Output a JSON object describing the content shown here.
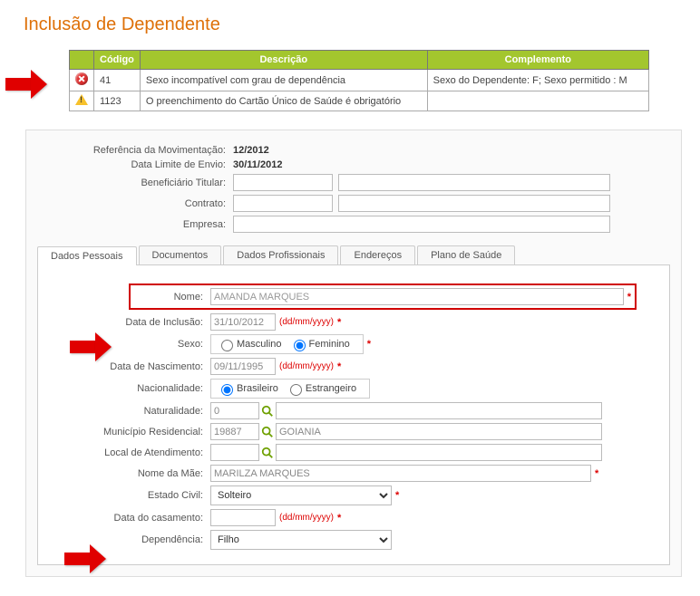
{
  "page_title": "Inclusão de Dependente",
  "errors_table": {
    "headers": {
      "code": "Código",
      "desc": "Descrição",
      "comp": "Complemento"
    },
    "rows": [
      {
        "icon": "error",
        "code": "41",
        "desc": "Sexo incompatível com grau de dependência",
        "comp": "Sexo do Dependente: F; Sexo permitido : M"
      },
      {
        "icon": "warn",
        "code": "1123",
        "desc": "O preenchimento do Cartão Único de Saúde é obrigatório",
        "comp": ""
      }
    ]
  },
  "info": {
    "ref_label": "Referência da Movimentação:",
    "ref_value": "12/2012",
    "limit_label": "Data Limite de Envio:",
    "limit_value": "30/11/2012",
    "titular_label": "Beneficiário Titular:",
    "contrato_label": "Contrato:",
    "empresa_label": "Empresa:"
  },
  "tabs": [
    "Dados Pessoais",
    "Documentos",
    "Dados Profissionais",
    "Endereços",
    "Plano de Saúde"
  ],
  "form": {
    "nome_label": "Nome:",
    "nome_value": "AMANDA MARQUES",
    "incl_label": "Data de Inclusão:",
    "incl_value": "31/10/2012",
    "sexo_label": "Sexo:",
    "sexo_m": "Masculino",
    "sexo_f": "Feminino",
    "nasc_label": "Data de Nascimento:",
    "nasc_value": "09/11/1995",
    "nac_label": "Nacionalidade:",
    "nac_br": "Brasileiro",
    "nac_es": "Estrangeiro",
    "nat_label": "Naturalidade:",
    "nat_code": "0",
    "mun_label": "Município Residencial:",
    "mun_code": "19887",
    "mun_name": "GOIANIA",
    "loc_label": "Local de Atendimento:",
    "mae_label": "Nome da Mãe:",
    "mae_value": "MARILZA MARQUES",
    "ec_label": "Estado Civil:",
    "ec_value": "Solteiro",
    "cas_label": "Data do casamento:",
    "dep_label": "Dependência:",
    "dep_value": "Filho",
    "date_hint": "(dd/mm/yyyy)",
    "asterisk": "*"
  }
}
